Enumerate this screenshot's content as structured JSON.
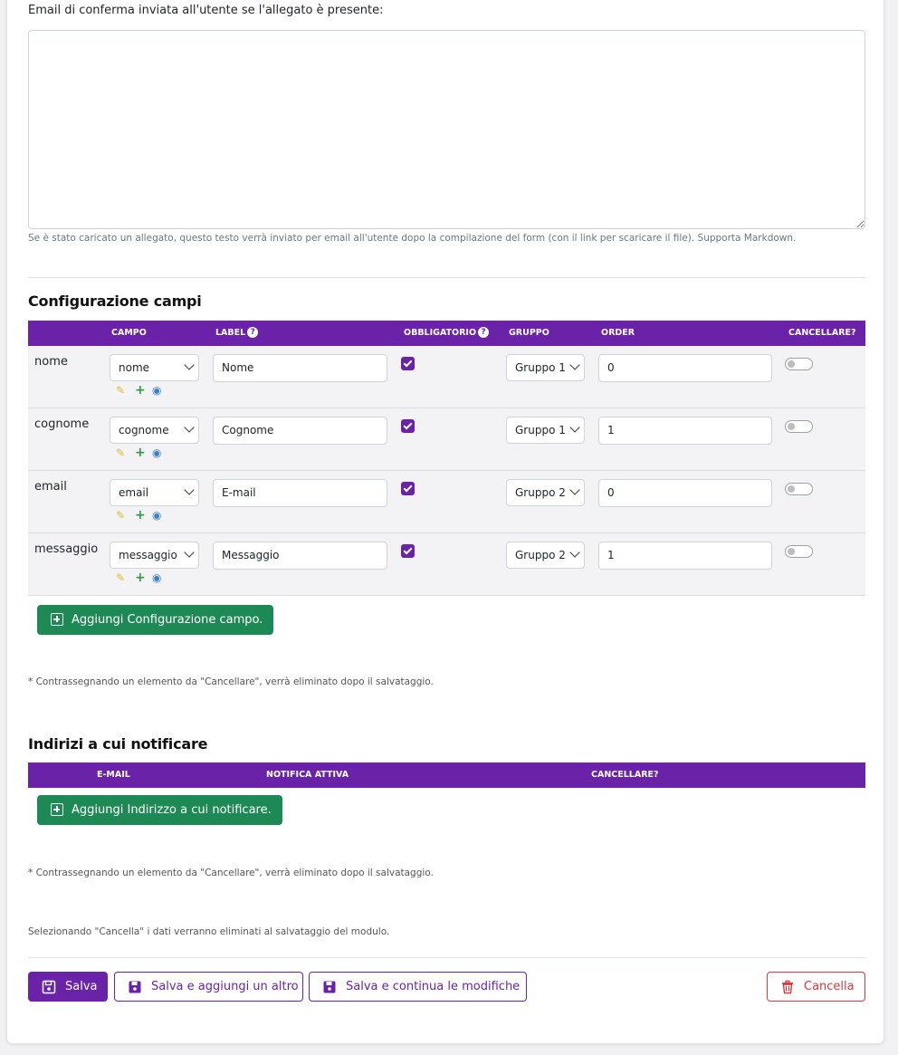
{
  "confirm_email": {
    "label": "Email di conferma inviata all'utente se l'allegato è presente:",
    "value": "",
    "help": "Se è stato caricato un allegato, questo testo verrà inviato per email all'utente dopo la compilazione del form (con il link per scaricare il file). Supporta Markdown."
  },
  "fields_section": {
    "title": "Configurazione campi",
    "headers": {
      "campo": "Campo",
      "label": "Label",
      "obbligatorio": "Obbligatorio",
      "gruppo": "Gruppo",
      "order": "Order",
      "cancellare": "Cancellare?"
    },
    "rows": [
      {
        "name": "nome",
        "campo": "nome",
        "label": "Nome",
        "obbligatorio": true,
        "gruppo": "Gruppo 1",
        "order": "0",
        "cancellare": false
      },
      {
        "name": "cognome",
        "campo": "cognome",
        "label": "Cognome",
        "obbligatorio": true,
        "gruppo": "Gruppo 1",
        "order": "1",
        "cancellare": false
      },
      {
        "name": "email",
        "campo": "email",
        "label": "E-mail",
        "obbligatorio": true,
        "gruppo": "Gruppo 2",
        "order": "0",
        "cancellare": false
      },
      {
        "name": "messaggio",
        "campo": "messaggio",
        "label": "Messaggio",
        "obbligatorio": true,
        "gruppo": "Gruppo 2",
        "order": "1",
        "cancellare": false
      }
    ],
    "add_button": "Aggiungi Configurazione campo.",
    "note": "* Contrassegnando un elemento da \"Cancellare\", verrà eliminato dopo il salvataggio."
  },
  "notify_section": {
    "title": "Indirizi a cui notificare",
    "headers": {
      "email": "E-mail",
      "notifica": "Notifica attiva",
      "cancellare": "Cancellare?"
    },
    "add_button": "Aggiungi Indirizzo a cui notificare.",
    "note": "* Contrassegnando un elemento da \"Cancellare\", verrà eliminato dopo il salvataggio."
  },
  "footer": {
    "delete_info": "Selezionando \"Cancella\" i dati verranno eliminati al salvataggio del modulo.",
    "save": "Salva",
    "save_add": "Salva e aggiungi un altro",
    "save_continue": "Salva e continua le modifiche",
    "delete": "Cancella"
  },
  "colors": {
    "primary": "#6a23a8",
    "success": "#1d8a55",
    "danger": "#d9383f"
  }
}
